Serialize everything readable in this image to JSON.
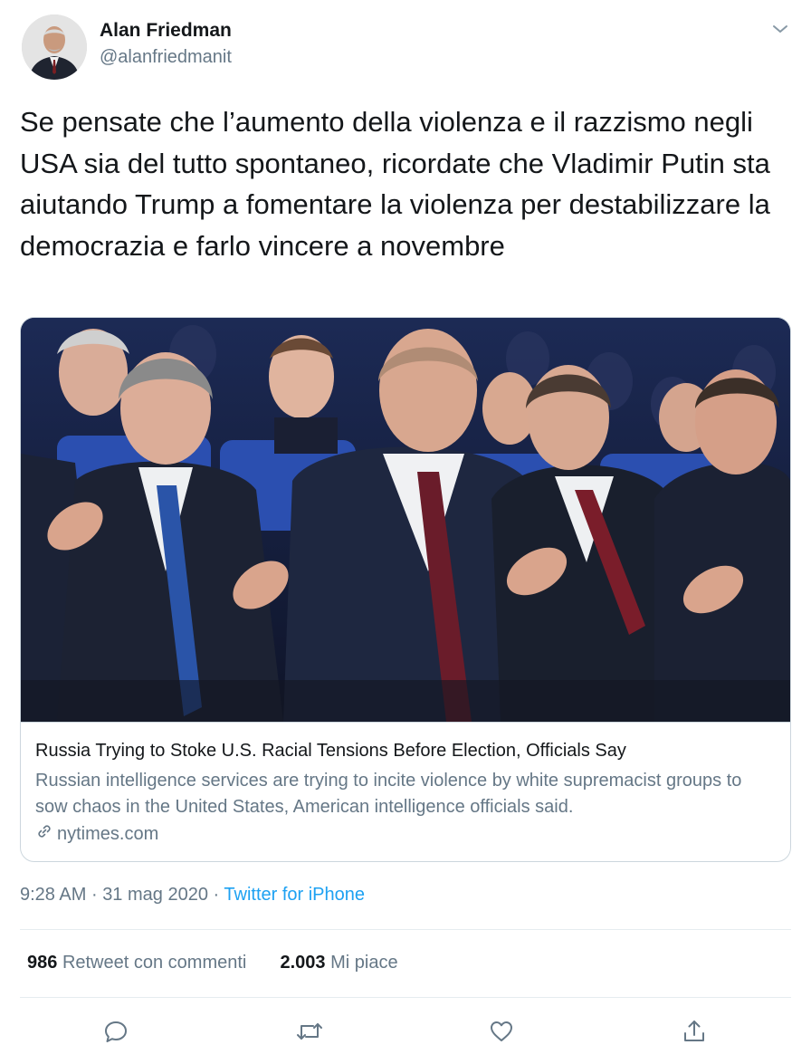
{
  "author": {
    "name": "Alan Friedman",
    "handle": "@alanfriedmanit"
  },
  "tweet": {
    "text": "Se pensate che l’aumento della violenza e il razzismo negli USA sia del tutto spontaneo, ricordate che Vladimir Putin sta aiutando Trump a fomentare la violenza per destabilizzare la democrazia e farlo vincere a novembre"
  },
  "card": {
    "title": "Russia Trying to Stoke U.S. Racial Tensions Before Election, Officials Say",
    "description": "Russian intelligence services are trying to incite violence by white supremacist groups to sow chaos in the United States, American intelligence officials said.",
    "domain": "nytimes.com",
    "domain_icon": "link-icon"
  },
  "meta": {
    "time": "9:28 AM",
    "separator": "·",
    "date": "31 mag 2020",
    "source": "Twitter for iPhone"
  },
  "stats": {
    "retweets_count": "986",
    "retweets_label": "Retweet con commenti",
    "likes_count": "2.003",
    "likes_label": "Mi piace"
  },
  "actions": {
    "icons": [
      "reply-icon",
      "retweet-icon",
      "like-icon",
      "share-icon"
    ]
  },
  "colors": {
    "text": "#14171a",
    "secondary": "#657786",
    "link": "#1da1f2",
    "border": "#ccd6dd"
  }
}
